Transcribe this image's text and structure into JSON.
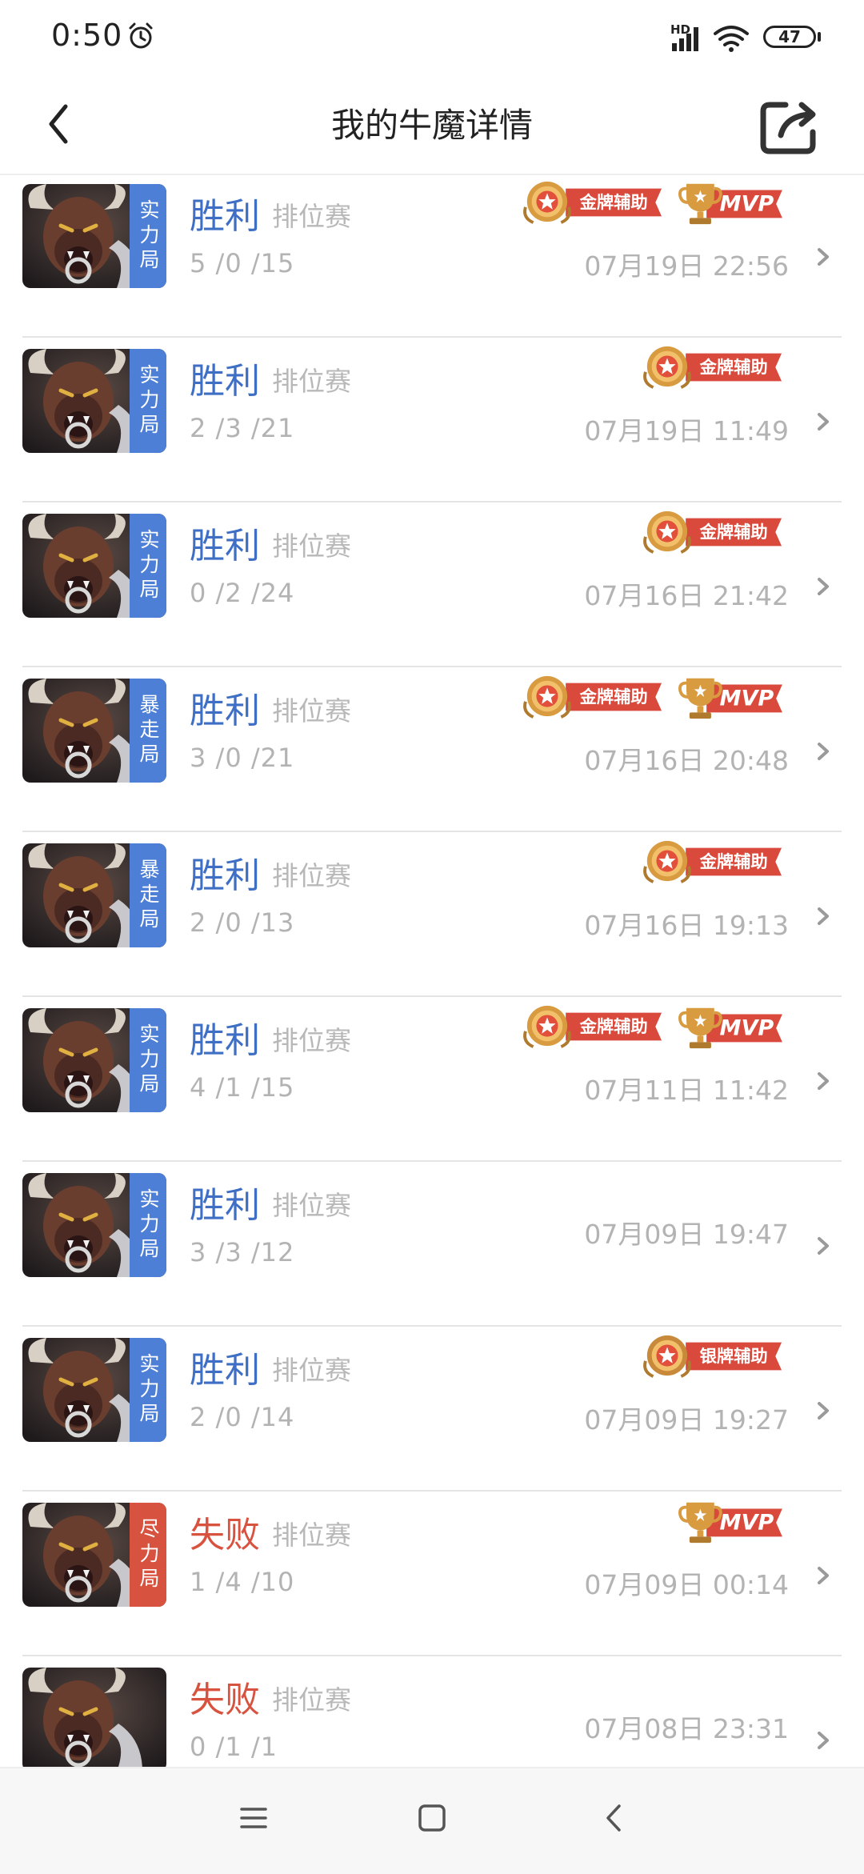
{
  "status": {
    "time": "0:50",
    "hd": "HD",
    "battery": "47"
  },
  "header": {
    "title": "我的牛魔详情"
  },
  "colors": {
    "win": "#3e6fc4",
    "loss": "#d8533f",
    "badge_blue": "#4d7fd6",
    "badge_red": "#d8533f",
    "ribbon": "#d94a3c",
    "medal_gold": "#d89b40"
  },
  "badge_labels": {
    "gold": "金牌辅助",
    "silver": "银牌辅助",
    "mvp": "MVP"
  },
  "matches": [
    {
      "mode": "实力局",
      "mode_color": "blue",
      "result": "胜利",
      "type": "排位赛",
      "kda": "5 /0 /15",
      "date": "07月19日 22:56",
      "badges": [
        "gold",
        "mvp"
      ]
    },
    {
      "mode": "实力局",
      "mode_color": "blue",
      "result": "胜利",
      "type": "排位赛",
      "kda": "2 /3 /21",
      "date": "07月19日 11:49",
      "badges": [
        "gold"
      ]
    },
    {
      "mode": "实力局",
      "mode_color": "blue",
      "result": "胜利",
      "type": "排位赛",
      "kda": "0 /2 /24",
      "date": "07月16日 21:42",
      "badges": [
        "gold"
      ]
    },
    {
      "mode": "暴走局",
      "mode_color": "blue",
      "result": "胜利",
      "type": "排位赛",
      "kda": "3 /0 /21",
      "date": "07月16日 20:48",
      "badges": [
        "gold",
        "mvp"
      ]
    },
    {
      "mode": "暴走局",
      "mode_color": "blue",
      "result": "胜利",
      "type": "排位赛",
      "kda": "2 /0 /13",
      "date": "07月16日 19:13",
      "badges": [
        "gold"
      ]
    },
    {
      "mode": "实力局",
      "mode_color": "blue",
      "result": "胜利",
      "type": "排位赛",
      "kda": "4 /1 /15",
      "date": "07月11日 11:42",
      "badges": [
        "gold",
        "mvp"
      ]
    },
    {
      "mode": "实力局",
      "mode_color": "blue",
      "result": "胜利",
      "type": "排位赛",
      "kda": "3 /3 /12",
      "date": "07月09日 19:47",
      "badges": []
    },
    {
      "mode": "实力局",
      "mode_color": "blue",
      "result": "胜利",
      "type": "排位赛",
      "kda": "2 /0 /14",
      "date": "07月09日 19:27",
      "badges": [
        "silver"
      ]
    },
    {
      "mode": "尽力局",
      "mode_color": "red",
      "result": "失败",
      "type": "排位赛",
      "kda": "1 /4 /10",
      "date": "07月09日 00:14",
      "badges": [
        "mvp"
      ]
    },
    {
      "mode": "",
      "mode_color": "none",
      "result": "失败",
      "type": "排位赛",
      "kda": "0 /1 /1",
      "date": "07月08日 23:31",
      "badges": []
    }
  ],
  "icons": {
    "back": "back-arrow-icon",
    "share": "share-icon",
    "alarm": "alarm-clock-icon",
    "signal": "signal-icon",
    "wifi": "wifi-icon"
  }
}
